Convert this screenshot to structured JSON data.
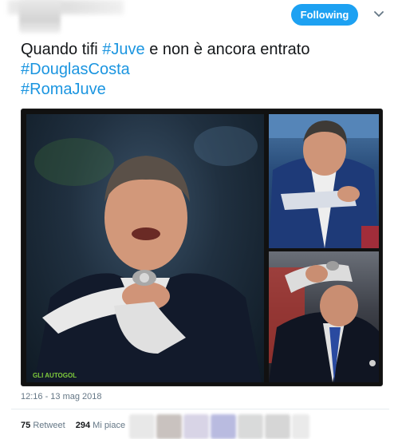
{
  "header": {
    "follow_label": "Following"
  },
  "tweet": {
    "line1_text": "Quando tifi ",
    "line1_hashtag": "#Juve",
    "line1_rest": " e non è ancora entrato",
    "hashtag2": "#DouglasCosta",
    "hashtag3": "#RomaJuve"
  },
  "media": {
    "watermark": "GLI AUTOGOL"
  },
  "meta": {
    "timestamp": "12:16 - 13 mag 2018"
  },
  "stats": {
    "retweets_count": "75",
    "retweets_label": "Retweet",
    "likes_count": "294",
    "likes_label": "Mi piace"
  },
  "colors": {
    "accent": "#1da1f2",
    "hashtag": "#1b95e0",
    "muted": "#657786"
  }
}
